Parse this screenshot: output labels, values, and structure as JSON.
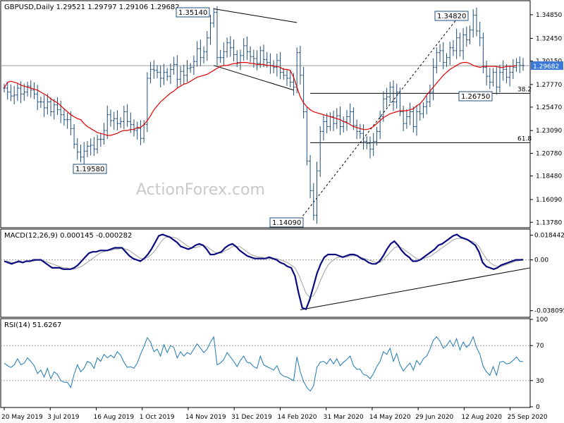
{
  "chart_data": [
    {
      "type": "ohlc",
      "panel": "price",
      "legend": "GBPUSD,Daily  1.29521 1.29797 1.29106 1.29682",
      "yticks": [
        1.3485,
        1.3245,
        1.3015,
        1.2777,
        1.2547,
        1.2309,
        1.2078,
        1.1848,
        1.1609,
        1.1378
      ],
      "ytick_labels": [
        "1.34850",
        "1.32450",
        "1.30150",
        "1.27770",
        "1.25470",
        "1.23090",
        "1.20780",
        "1.18480",
        "1.16090",
        "1.13780"
      ],
      "ylim": [
        1.133,
        1.362
      ],
      "current_price": 1.29682,
      "current_price_label": "1.29682",
      "annotations": [
        {
          "label": "1.35140",
          "value": 1.3514
        },
        {
          "label": "1.34820",
          "value": 1.3482
        },
        {
          "label": "1.19580",
          "value": 1.1958
        },
        {
          "label": "1.14090",
          "value": 1.1409
        },
        {
          "label": "1.26750",
          "value": 1.2675
        }
      ],
      "fib_levels": [
        {
          "label": "38.2",
          "value": 1.2687
        },
        {
          "label": "61.8",
          "value": 1.2186
        }
      ],
      "series": [
        {
          "name": "close",
          "values": [
            1.274,
            1.27,
            1.266,
            1.267,
            1.274,
            1.268,
            1.27,
            1.276,
            1.272,
            1.268,
            1.26,
            1.26,
            1.254,
            1.26,
            1.25,
            1.257,
            1.252,
            1.247,
            1.242,
            1.242,
            1.233,
            1.217,
            1.209,
            1.204,
            1.21,
            1.215,
            1.216,
            1.212,
            1.222,
            1.222,
            1.231,
            1.247,
            1.241,
            1.243,
            1.238,
            1.24,
            1.25,
            1.24,
            1.237,
            1.231,
            1.233,
            1.223,
            1.237,
            1.284,
            1.293,
            1.292,
            1.29,
            1.284,
            1.29,
            1.286,
            1.293,
            1.298,
            1.283,
            1.291,
            1.287,
            1.294,
            1.295,
            1.301,
            1.314,
            1.305,
            1.311,
            1.325,
            1.34,
            1.351,
            1.305,
            1.305,
            1.311,
            1.32,
            1.315,
            1.308,
            1.3,
            1.307,
            1.317,
            1.311,
            1.306,
            1.304,
            1.299,
            1.312,
            1.303,
            1.3,
            1.297,
            1.295,
            1.302,
            1.29,
            1.287,
            1.284,
            1.28,
            1.275,
            1.31,
            1.287,
            1.25,
            1.2,
            1.17,
            1.145,
            1.19,
            1.23,
            1.24,
            1.235,
            1.245,
            1.238,
            1.246,
            1.235,
            1.24,
            1.245,
            1.25,
            1.236,
            1.23,
            1.228,
            1.22,
            1.218,
            1.212,
            1.22,
            1.23,
            1.245,
            1.263,
            1.265,
            1.275,
            1.26,
            1.27,
            1.25,
            1.238,
            1.245,
            1.25,
            1.235,
            1.25,
            1.248,
            1.255,
            1.26,
            1.27,
            1.295,
            1.31,
            1.312,
            1.3,
            1.305,
            1.315,
            1.312,
            1.325,
            1.312,
            1.328,
            1.323,
            1.333,
            1.348,
            1.332,
            1.325,
            1.295,
            1.286,
            1.28,
            1.29,
            1.275,
            1.29,
            1.293,
            1.285,
            1.29,
            1.295,
            1.3,
            1.297,
            1.2968
          ]
        },
        {
          "name": "SMA",
          "values": [
            1.274,
            1.28,
            1.281,
            1.28,
            1.279,
            1.277,
            1.276,
            1.275,
            1.274,
            1.273,
            1.272,
            1.27,
            1.268,
            1.266,
            1.263,
            1.261,
            1.259,
            1.256,
            1.253,
            1.25,
            1.247,
            1.245,
            1.243,
            1.242,
            1.238,
            1.235,
            1.233,
            1.231,
            1.229,
            1.228,
            1.227,
            1.226,
            1.226,
            1.227,
            1.228,
            1.23,
            1.231,
            1.231,
            1.232,
            1.232,
            1.234,
            1.234,
            1.237,
            1.241,
            1.246,
            1.252,
            1.256,
            1.26,
            1.263,
            1.266,
            1.269,
            1.271,
            1.274,
            1.276,
            1.278,
            1.279,
            1.281,
            1.283,
            1.285,
            1.286,
            1.287,
            1.288,
            1.29,
            1.292,
            1.294,
            1.296,
            1.297,
            1.297,
            1.298,
            1.299,
            1.299,
            1.3,
            1.3,
            1.3,
            1.299,
            1.299,
            1.298,
            1.298,
            1.298,
            1.297,
            1.297,
            1.296,
            1.296,
            1.295,
            1.293,
            1.293,
            1.292,
            1.285,
            1.275,
            1.265,
            1.259,
            1.255,
            1.252,
            1.25,
            1.249,
            1.248,
            1.247,
            1.246,
            1.245,
            1.244,
            1.243,
            1.242,
            1.24,
            1.239,
            1.237,
            1.235,
            1.234,
            1.233,
            1.232,
            1.232,
            1.233,
            1.235,
            1.238,
            1.241,
            1.244,
            1.246,
            1.248,
            1.249,
            1.25,
            1.251,
            1.251,
            1.251,
            1.252,
            1.253,
            1.256,
            1.258,
            1.262,
            1.267,
            1.271,
            1.275,
            1.279,
            1.283,
            1.287,
            1.29,
            1.293,
            1.295,
            1.297,
            1.299,
            1.3,
            1.3,
            1.299,
            1.297,
            1.296,
            1.295,
            1.296,
            1.296,
            1.296,
            1.296,
            1.296,
            1.295,
            1.295,
            1.296,
            1.296,
            1.296,
            1.297
          ]
        }
      ]
    },
    {
      "type": "line",
      "panel": "macd",
      "legend": "MACD(12,26,9) 0.000145 -0.000282",
      "yticks": [
        0.018442,
        0.0,
        -0.038095
      ],
      "ytick_labels": [
        "0.018442",
        "0.00",
        "-0.038095"
      ],
      "ylim": [
        -0.0425,
        0.0225
      ],
      "series": [
        {
          "name": "MACD",
          "values": [
            -0.001,
            -0.002,
            -0.003,
            -0.002,
            -0.001,
            -0.002,
            -0.001,
            -0.001,
            0.0,
            0.0,
            0.0,
            -0.002,
            -0.004,
            -0.006,
            -0.006,
            -0.006,
            -0.007,
            -0.007,
            -0.007,
            -0.006,
            -0.004,
            -0.001,
            0.002,
            0.005,
            0.006,
            0.006,
            0.007,
            0.007,
            0.007,
            0.008,
            0.009,
            0.009,
            0.009,
            0.006,
            0.003,
            0.001,
            0.0,
            -0.001,
            0.001,
            0.004,
            0.008,
            0.013,
            0.018,
            0.019,
            0.018,
            0.017,
            0.015,
            0.013,
            0.01,
            0.009,
            0.008,
            0.009,
            0.011,
            0.012,
            0.011,
            0.008,
            0.004,
            0.004,
            0.005,
            0.006,
            0.009,
            0.011,
            0.012,
            0.01,
            0.007,
            0.005,
            0.003,
            0.002,
            0.001,
            0.001,
            0.001,
            0.001,
            0.002,
            0.001,
            0.0,
            -0.002,
            -0.003,
            -0.005,
            -0.006,
            -0.012,
            -0.025,
            -0.036,
            -0.037,
            -0.03,
            -0.02,
            -0.01,
            -0.003,
            0.002,
            0.004,
            0.004,
            0.004,
            0.003,
            0.002,
            0.003,
            0.004,
            0.004,
            0.003,
            0.001,
            0.0,
            -0.002,
            -0.003,
            -0.003,
            -0.001,
            0.003,
            0.008,
            0.012,
            0.014,
            0.011,
            0.007,
            0.004,
            0.002,
            -0.001,
            -0.001,
            0.0,
            0.002,
            0.004,
            0.006,
            0.008,
            0.011,
            0.012,
            0.014,
            0.016,
            0.018,
            0.019,
            0.017,
            0.016,
            0.015,
            0.013,
            0.011,
            0.006,
            -0.002,
            -0.005,
            -0.006,
            -0.007,
            -0.006,
            -0.004,
            -0.003,
            -0.002,
            -0.001,
            0.0,
            0.0,
            0.0001
          ]
        },
        {
          "name": "Signal",
          "values": [
            -0.001,
            -0.001,
            -0.002,
            -0.002,
            -0.002,
            -0.002,
            -0.001,
            -0.001,
            -0.001,
            0.0,
            0.0,
            -0.001,
            -0.002,
            -0.003,
            -0.004,
            -0.005,
            -0.006,
            -0.006,
            -0.007,
            -0.007,
            -0.006,
            -0.005,
            -0.003,
            -0.001,
            0.001,
            0.003,
            0.005,
            0.006,
            0.007,
            0.007,
            0.008,
            0.008,
            0.009,
            0.008,
            0.007,
            0.005,
            0.003,
            0.001,
            0.001,
            0.002,
            0.004,
            0.007,
            0.011,
            0.015,
            0.017,
            0.017,
            0.017,
            0.016,
            0.014,
            0.012,
            0.01,
            0.009,
            0.009,
            0.01,
            0.011,
            0.01,
            0.008,
            0.006,
            0.005,
            0.005,
            0.007,
            0.008,
            0.01,
            0.01,
            0.01,
            0.008,
            0.006,
            0.004,
            0.003,
            0.002,
            0.002,
            0.001,
            0.001,
            0.001,
            0.001,
            0.0,
            -0.001,
            -0.002,
            -0.004,
            -0.006,
            -0.011,
            -0.018,
            -0.025,
            -0.028,
            -0.027,
            -0.022,
            -0.015,
            -0.009,
            -0.004,
            -0.001,
            0.001,
            0.002,
            0.002,
            0.002,
            0.003,
            0.003,
            0.003,
            0.002,
            0.001,
            0.0,
            -0.001,
            -0.002,
            -0.002,
            0.0,
            0.003,
            0.006,
            0.009,
            0.01,
            0.009,
            0.007,
            0.005,
            0.003,
            0.001,
            0.0,
            0.001,
            0.002,
            0.003,
            0.005,
            0.007,
            0.009,
            0.011,
            0.013,
            0.015,
            0.016,
            0.016,
            0.016,
            0.015,
            0.014,
            0.013,
            0.01,
            0.005,
            0.001,
            -0.002,
            -0.004,
            -0.005,
            -0.005,
            -0.004,
            -0.003,
            -0.002,
            -0.001,
            -0.0005,
            -0.0003
          ]
        }
      ]
    },
    {
      "type": "line",
      "panel": "rsi",
      "legend": "RSI(14) 51.6267",
      "yticks": [
        100,
        70,
        30,
        0
      ],
      "ytick_labels": [
        "100",
        "70",
        "30",
        "0"
      ],
      "ylim": [
        0,
        100
      ],
      "series": [
        {
          "name": "RSI",
          "values": [
            50,
            47,
            45,
            48,
            55,
            48,
            50,
            56,
            52,
            47,
            38,
            42,
            34,
            44,
            32,
            40,
            37,
            30,
            28,
            28,
            22,
            37,
            48,
            40,
            44,
            52,
            50,
            44,
            56,
            52,
            60,
            56,
            59,
            56,
            63,
            59,
            51,
            45,
            46,
            44,
            50,
            60,
            69,
            79,
            74,
            63,
            66,
            58,
            71,
            62,
            70,
            68,
            56,
            63,
            58,
            62,
            60,
            66,
            72,
            67,
            62,
            66,
            74,
            80,
            48,
            50,
            54,
            62,
            57,
            52,
            46,
            53,
            58,
            51,
            50,
            46,
            44,
            58,
            48,
            46,
            44,
            42,
            47,
            38,
            35,
            34,
            32,
            30,
            57,
            40,
            29,
            22,
            18,
            24,
            45,
            51,
            52,
            49,
            55,
            49,
            55,
            47,
            51,
            54,
            58,
            47,
            43,
            43,
            37,
            36,
            32,
            38,
            46,
            52,
            63,
            60,
            67,
            52,
            61,
            48,
            41,
            46,
            50,
            42,
            53,
            48,
            55,
            58,
            66,
            76,
            80,
            75,
            67,
            70,
            76,
            69,
            78,
            65,
            74,
            68,
            72,
            80,
            68,
            60,
            46,
            40,
            36,
            46,
            36,
            51,
            52,
            49,
            50,
            53,
            57,
            52,
            51.6
          ]
        }
      ]
    }
  ],
  "xaxis": {
    "labels": [
      "20 May 2019",
      "3 Jul 2019",
      "16 Aug 2019",
      "1 Oct 2019",
      "14 Nov 2019",
      "31 Dec 2019",
      "14 Feb 2020",
      "31 Mar 2020",
      "14 May 2020",
      "29 Jun 2020",
      "12 Aug 2020",
      "25 Sep 2020"
    ]
  },
  "watermark": "ActionForex.com",
  "colors": {
    "price_bars": "#1f4e79",
    "sma": "#e00000",
    "macd": "#0a0a80",
    "signal": "#a0a0a0",
    "rsi": "#1f78b4",
    "trendline": "#000000",
    "grid_dash": "#9a9a9a",
    "current_price_box": "#3c78d8"
  }
}
